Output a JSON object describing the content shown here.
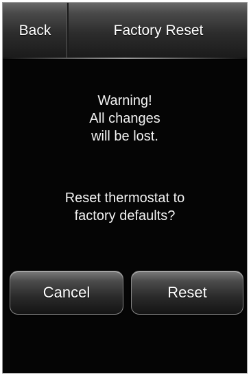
{
  "header": {
    "back_label": "Back",
    "title": "Factory Reset"
  },
  "warning": {
    "line1": "Warning!",
    "line2": "All changes",
    "line3": "will be lost."
  },
  "question": {
    "line1": "Reset thermostat to",
    "line2": "factory defaults?"
  },
  "buttons": {
    "cancel_label": "Cancel",
    "reset_label": "Reset"
  }
}
